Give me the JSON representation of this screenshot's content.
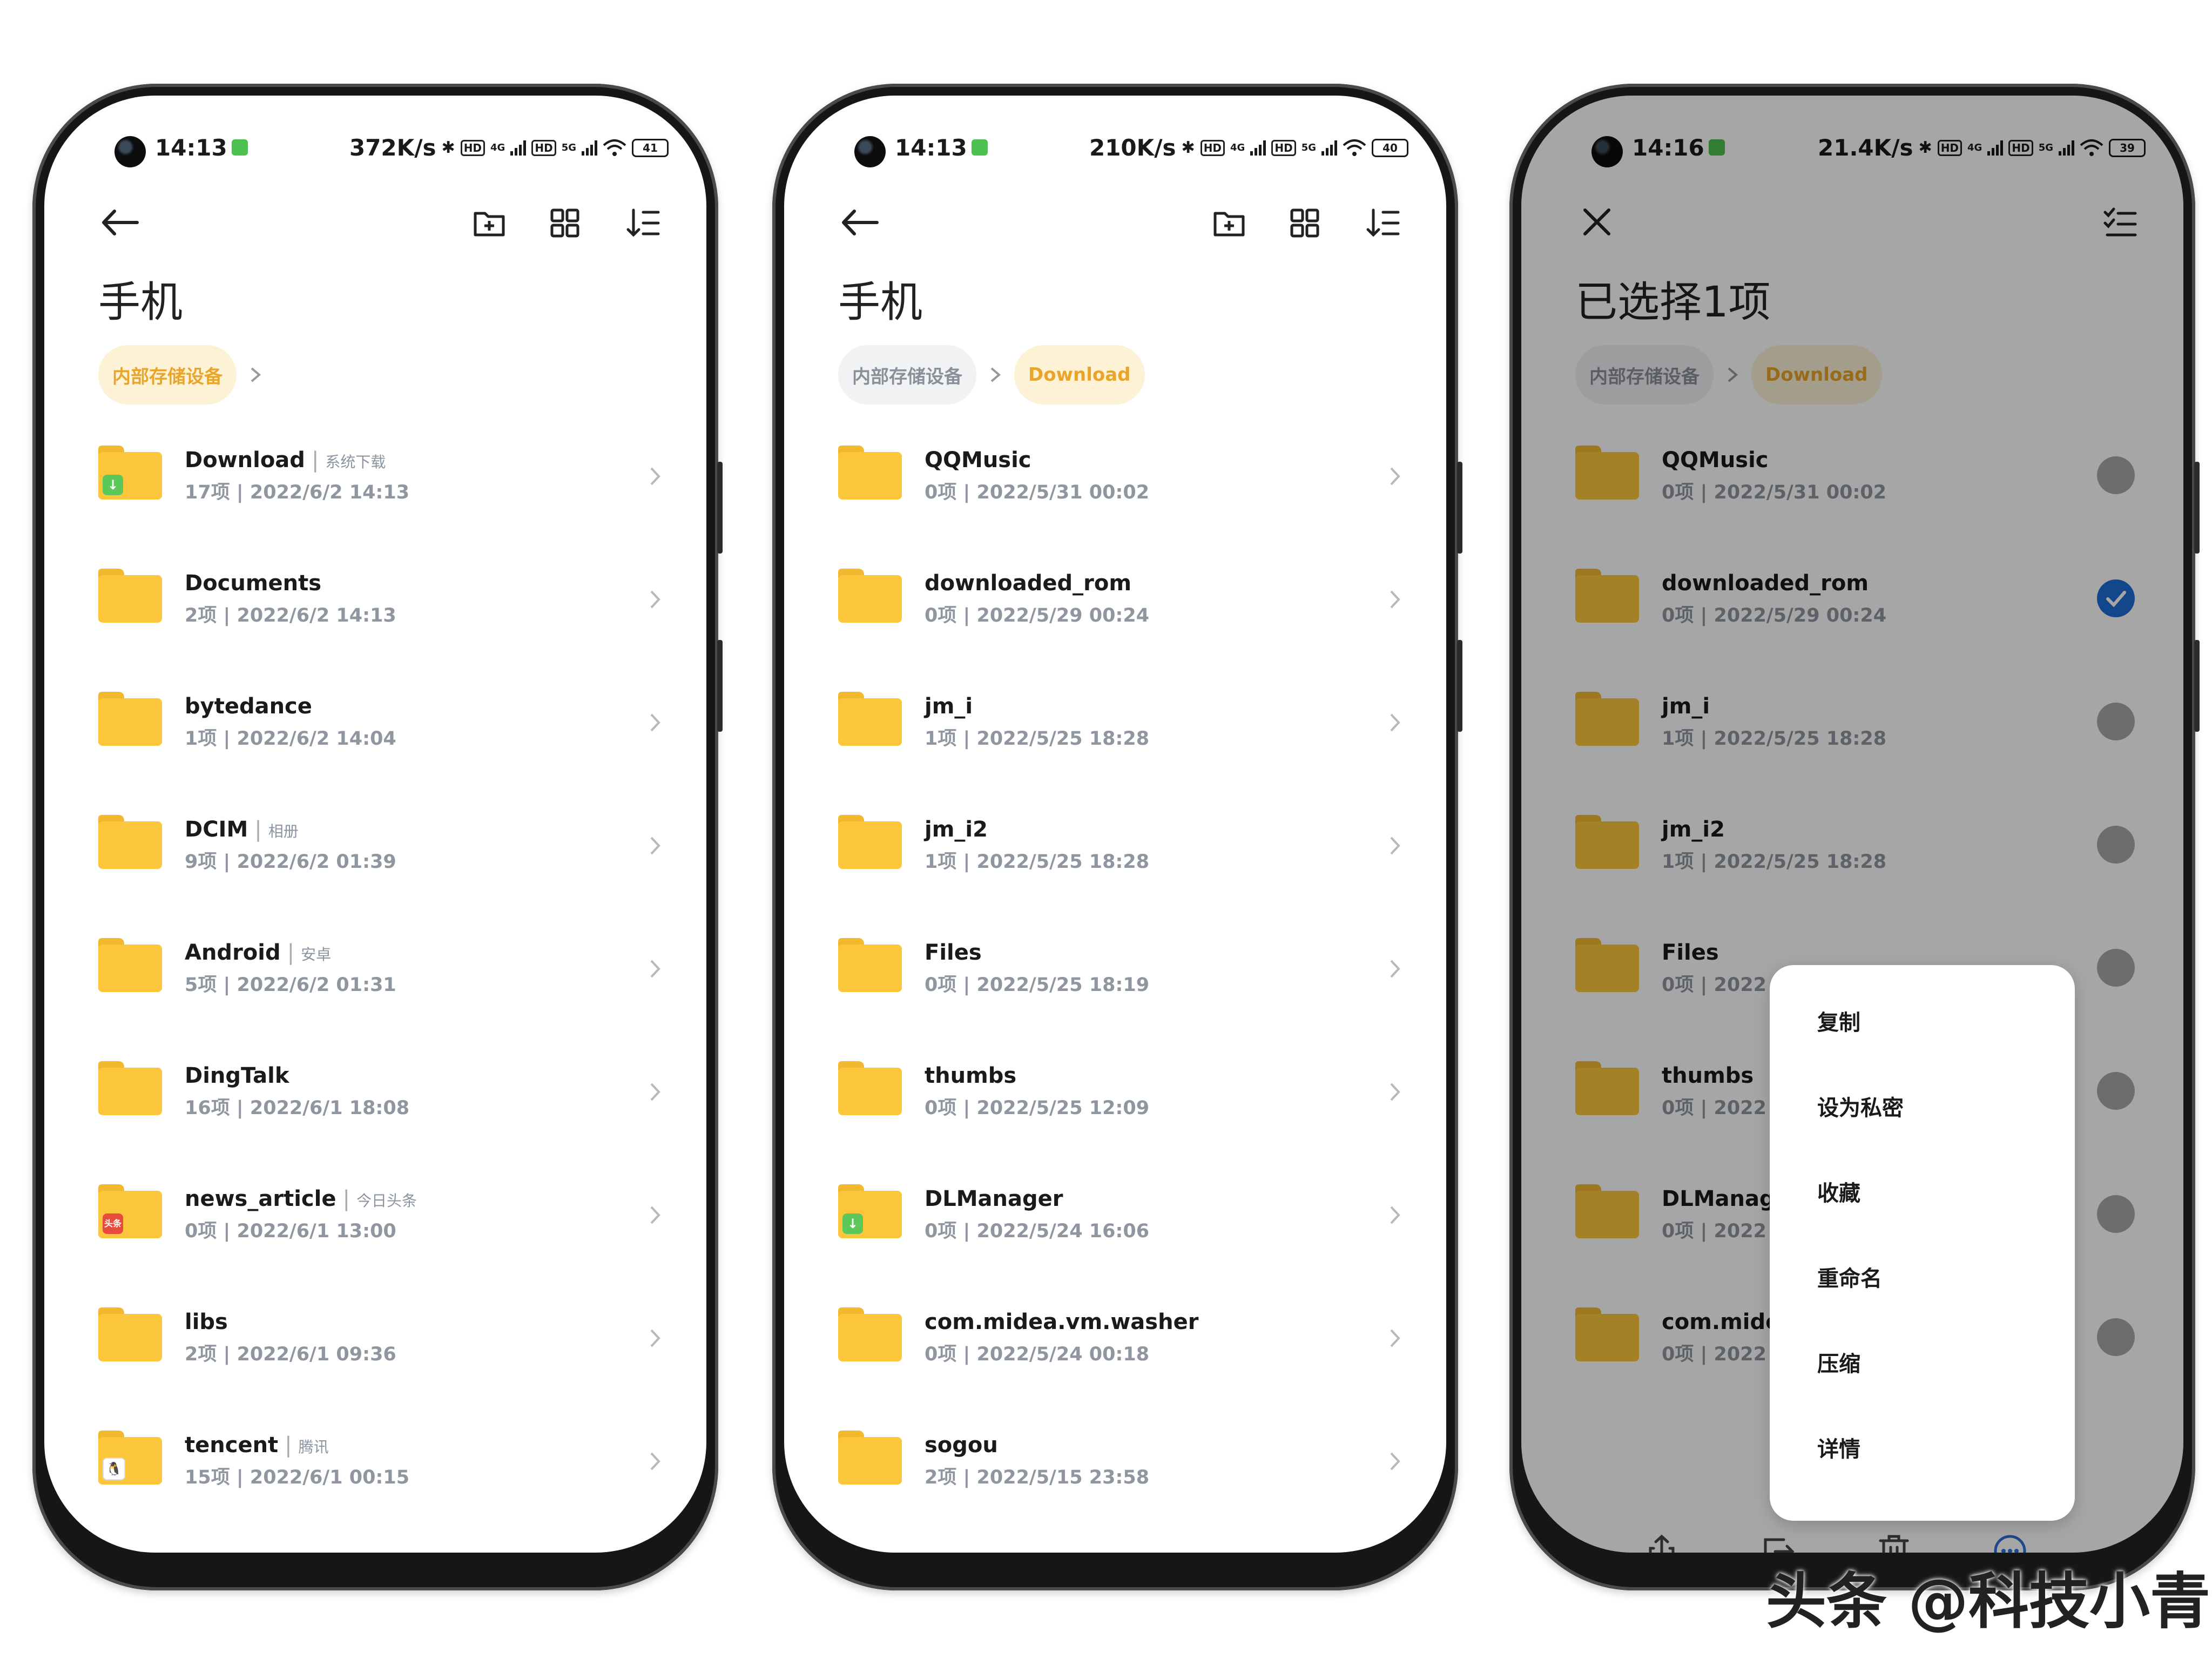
{
  "phones": [
    {
      "status": {
        "time": "14:13",
        "speed": "372K/s",
        "battery": "41"
      },
      "title": "手机",
      "breadcrumbs": [
        "内部存储设备"
      ],
      "folders": [
        {
          "name": "Download",
          "tag": "系统下载",
          "meta": "17项  |  2022/6/2 14:13",
          "badge": "download"
        },
        {
          "name": "Documents",
          "tag": "",
          "meta": "2项  |  2022/6/2 14:13"
        },
        {
          "name": "bytedance",
          "tag": "",
          "meta": "1项  |  2022/6/2 14:04"
        },
        {
          "name": "DCIM",
          "tag": "相册",
          "meta": "9项  |  2022/6/2 01:39"
        },
        {
          "name": "Android",
          "tag": "安卓",
          "meta": "5项  |  2022/6/2 01:31"
        },
        {
          "name": "DingTalk",
          "tag": "",
          "meta": "16项  |  2022/6/1 18:08"
        },
        {
          "name": "news_article",
          "tag": "今日头条",
          "meta": "0项  |  2022/6/1 13:00",
          "badge": "toutiao"
        },
        {
          "name": "libs",
          "tag": "",
          "meta": "2项  |  2022/6/1 09:36"
        },
        {
          "name": "tencent",
          "tag": "腾讯",
          "meta": "15项  |  2022/6/1 00:15",
          "badge": "qq"
        }
      ]
    },
    {
      "status": {
        "time": "14:13",
        "speed": "210K/s",
        "battery": "40"
      },
      "title": "手机",
      "breadcrumbs": [
        "内部存储设备",
        "Download"
      ],
      "folders": [
        {
          "name": "QQMusic",
          "meta": "0项  |  2022/5/31 00:02"
        },
        {
          "name": "downloaded_rom",
          "meta": "0项  |  2022/5/29 00:24"
        },
        {
          "name": "jm_i",
          "meta": "1项  |  2022/5/25 18:28"
        },
        {
          "name": "jm_i2",
          "meta": "1项  |  2022/5/25 18:28"
        },
        {
          "name": "Files",
          "meta": "0项  |  2022/5/25 18:19"
        },
        {
          "name": "thumbs",
          "meta": "0项  |  2022/5/25 12:09"
        },
        {
          "name": "DLManager",
          "meta": "0项  |  2022/5/24 16:06",
          "badge": "download"
        },
        {
          "name": "com.midea.vm.washer",
          "meta": "0项  |  2022/5/24 00:18"
        },
        {
          "name": "sogou",
          "meta": "2项  |  2022/5/15 23:58"
        }
      ]
    },
    {
      "status": {
        "time": "14:16",
        "speed": "21.4K/s",
        "battery": "39"
      },
      "title": "已选择1项",
      "breadcrumbs": [
        "内部存储设备",
        "Download"
      ],
      "folders": [
        {
          "name": "QQMusic",
          "meta": "0项  |  2022/5/31 00:02",
          "checked": false
        },
        {
          "name": "downloaded_rom",
          "meta": "0项  |  2022/5/29 00:24",
          "checked": true
        },
        {
          "name": "jm_i",
          "meta": "1项  |  2022/5/25 18:28",
          "checked": false
        },
        {
          "name": "jm_i2",
          "meta": "1项  |  2022/5/25 18:28",
          "checked": false
        },
        {
          "name": "Files",
          "meta": "0项  |  2022",
          "checked": false
        },
        {
          "name": "thumbs",
          "meta": "0项  |  2022",
          "checked": false
        },
        {
          "name": "DLManag",
          "meta": "0项  |  2022",
          "checked": false
        },
        {
          "name": "com.mide",
          "meta": "0项  |  2022",
          "checked": false
        }
      ],
      "context_menu": [
        "复制",
        "设为私密",
        "收藏",
        "重命名",
        "压缩",
        "详情"
      ],
      "bottom_bar": [
        "发送",
        "移动",
        "删除",
        "更多"
      ]
    }
  ],
  "watermark": "头条 @科技小青",
  "colors": {
    "accent": "#e8a52a",
    "folder": "#fbc63c",
    "check": "#1e6ed8",
    "more": "#2b6fd8"
  }
}
